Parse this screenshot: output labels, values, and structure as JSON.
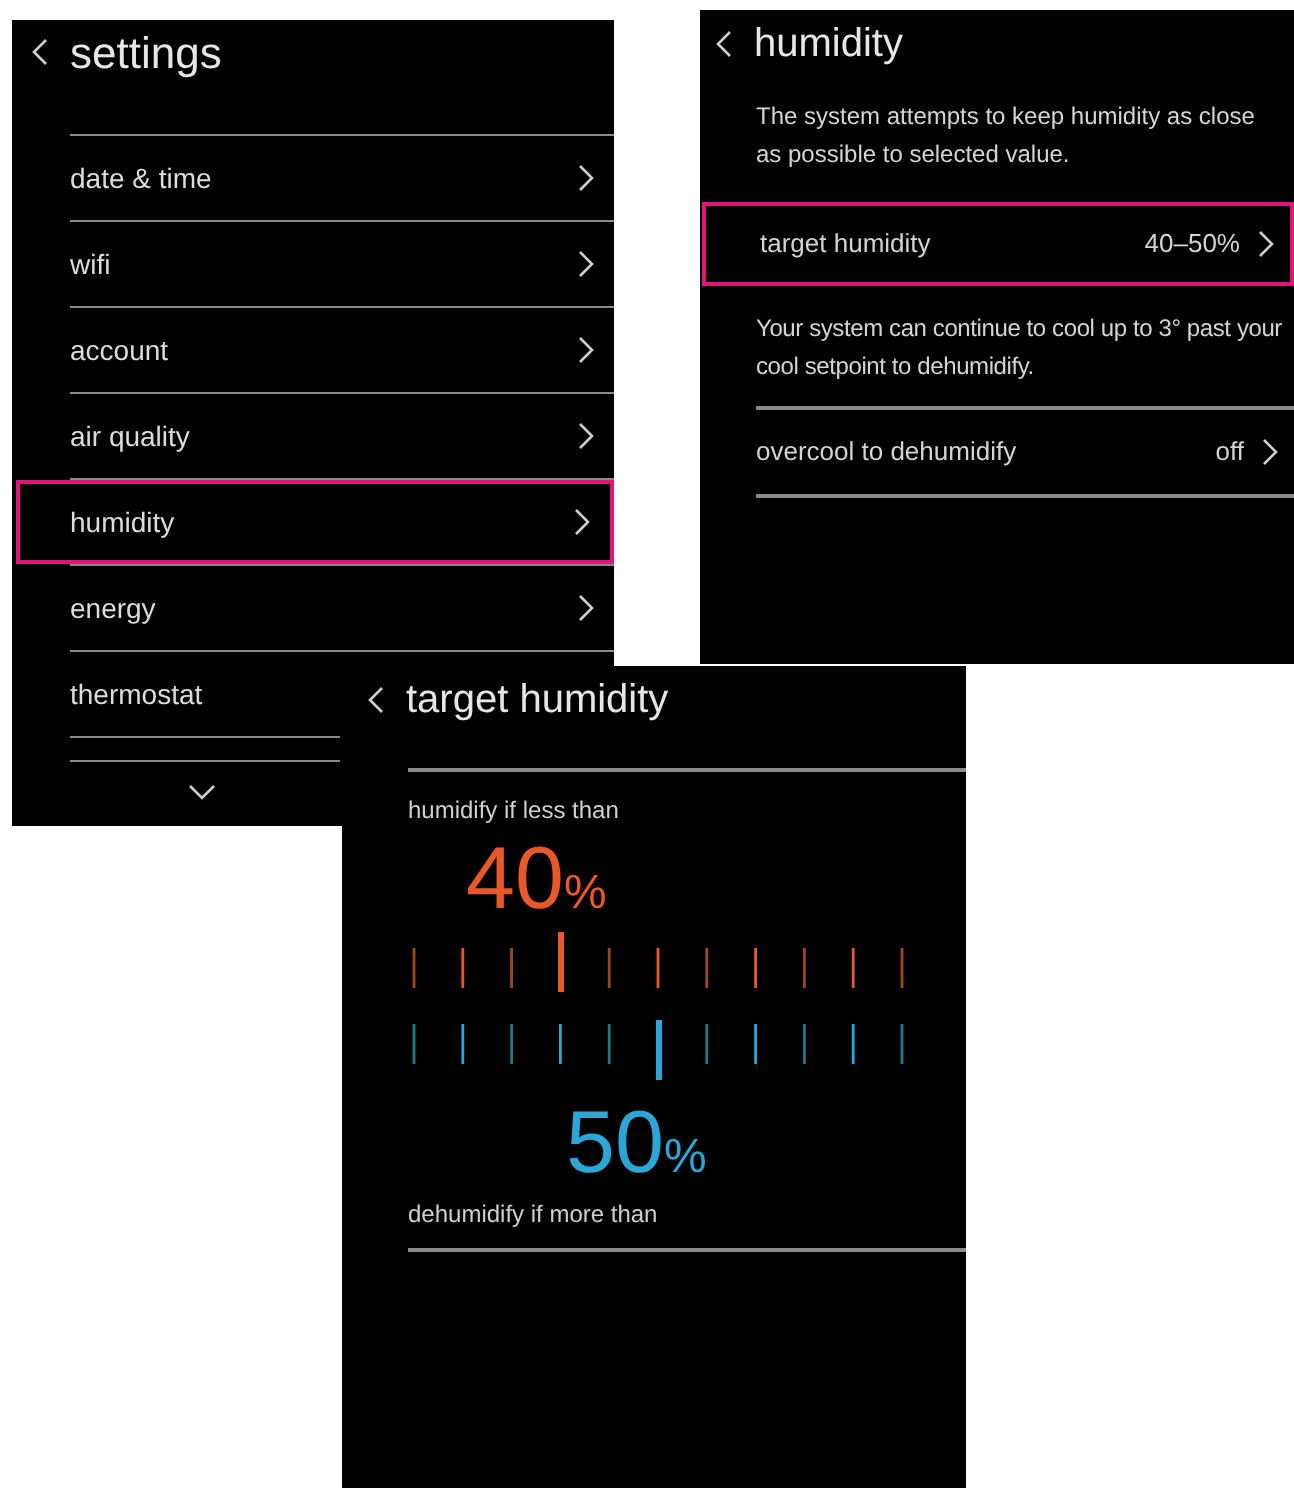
{
  "settings_screen": {
    "title": "settings",
    "items": [
      {
        "label": "date & time",
        "selected": false
      },
      {
        "label": "wifi",
        "selected": false
      },
      {
        "label": "account",
        "selected": false
      },
      {
        "label": "air quality",
        "selected": false
      },
      {
        "label": "humidity",
        "selected": true
      },
      {
        "label": "energy",
        "selected": false
      },
      {
        "label": "thermostat",
        "selected": false
      }
    ]
  },
  "humidity_screen": {
    "title": "humidity",
    "description": "The system attempts to keep humidity as close as possible to selected value.",
    "rows": [
      {
        "label": "target humidity",
        "value": "40–50%",
        "selected": true,
        "note": "Your system can continue to cool up to 3° past your cool setpoint to dehumidify."
      },
      {
        "label": "overcool to dehumidify",
        "value": "off",
        "selected": false
      }
    ]
  },
  "target_screen": {
    "title": "target humidity",
    "humidify": {
      "label": "humidify if less than",
      "value": "40",
      "unit": "%",
      "level": 0.3
    },
    "dehumidify": {
      "label": "dehumidify if more than",
      "value": "50",
      "unit": "%",
      "level": 0.5
    }
  }
}
